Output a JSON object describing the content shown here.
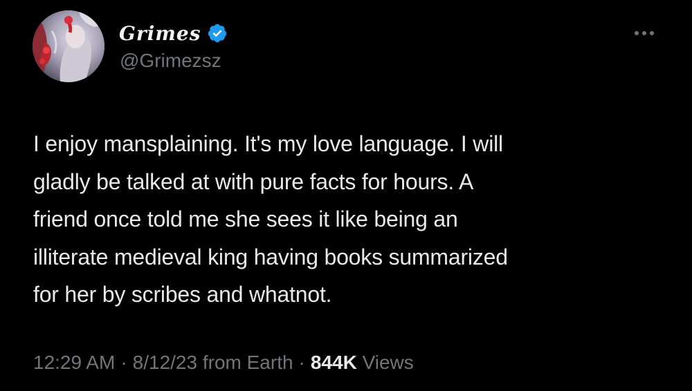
{
  "author": {
    "display_name": "Grimes",
    "handle": "@Grimezsz",
    "verified": true,
    "avatar_icon": "profile-avatar-image"
  },
  "tweet": {
    "text": "I enjoy mansplaining.  It's my love language.  I will\ngladly be talked at with pure facts for hours.   A\nfriend once told me she sees it like being an\nilliterate medieval king having books summarized\nfor her by scribes and whatnot."
  },
  "meta": {
    "time": "12:29 AM",
    "separator": "·",
    "date": "8/12/23",
    "source": "from Earth",
    "views_count": "844K",
    "views_label": "Views"
  },
  "icons": {
    "verified": "verified-badge-icon",
    "more": "more-options-icon"
  },
  "colors": {
    "background": "#000000",
    "text": "#e7e9ea",
    "secondary": "#71767b",
    "verified_blue": "#1d9bf0"
  }
}
